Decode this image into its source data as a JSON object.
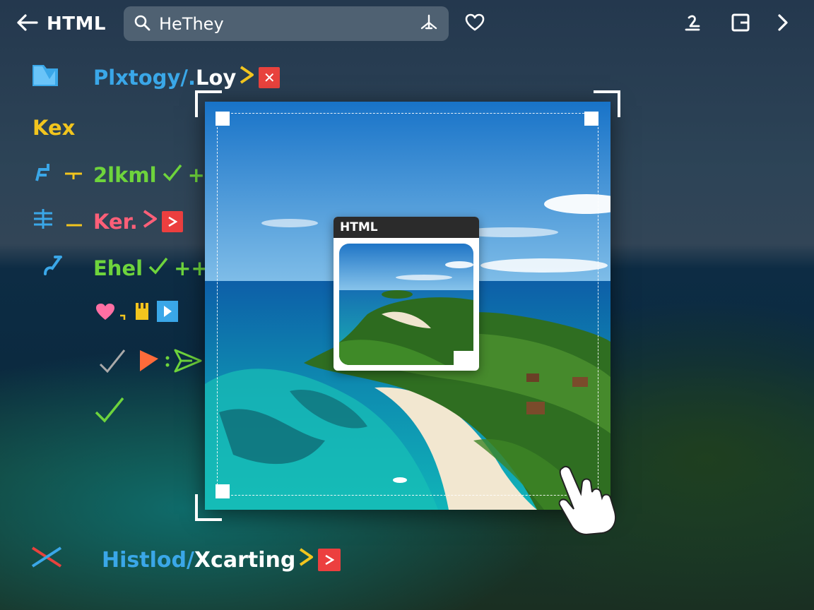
{
  "topbar": {
    "back_title": "HTML",
    "search_value": "HeThey"
  },
  "rows": [
    {
      "label": "Plxtogy/.",
      "label_tail": "Loy",
      "colors": [
        "#3aa7e8",
        "#ffffff"
      ]
    },
    {
      "label": "Kex",
      "colors": [
        "#f2c51e"
      ]
    },
    {
      "label": "2lkml",
      "suffix": "++",
      "colors": [
        "#6ed43c"
      ]
    },
    {
      "label": "Ker.",
      "colors": [
        "#ff5f78"
      ]
    },
    {
      "label": "Ehel",
      "suffix": "++",
      "colors": [
        "#6ed43c"
      ]
    },
    {
      "label": "",
      "colors": [
        "#ff6fa3"
      ]
    },
    {
      "label": "",
      "colors": [
        "#ff6b3a"
      ]
    },
    {
      "label": "",
      "colors": [
        "#6ed43c"
      ]
    }
  ],
  "preview": {
    "header": "HTML"
  },
  "bottom": {
    "label": "Histlod/",
    "label_tail": "Xcarting"
  },
  "accent_colors": {
    "cyan": "#3aa7e8",
    "yellow": "#f2c51e",
    "green": "#6ed43c",
    "red": "#e8423d",
    "pink": "#ff5f78"
  }
}
